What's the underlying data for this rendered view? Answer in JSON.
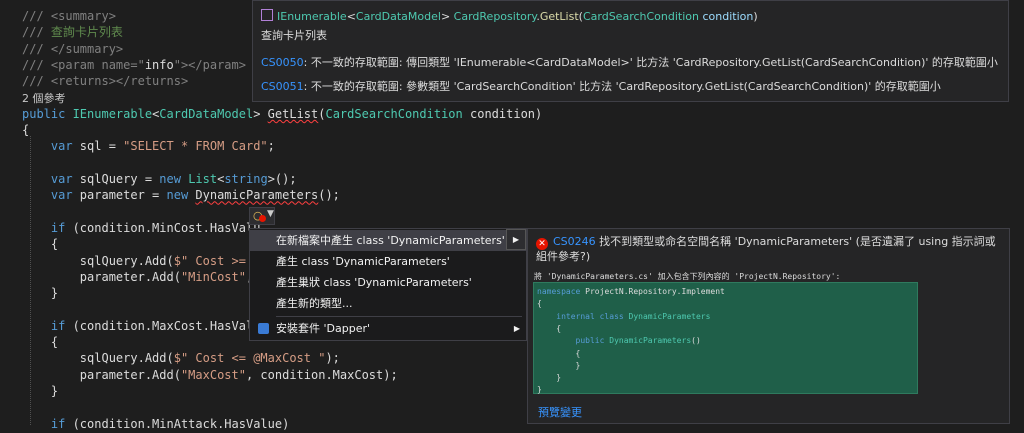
{
  "editor": {
    "lines": [
      {
        "parts": [
          {
            "c": "c-tag",
            "t": "/// "
          },
          {
            "c": "c-tag",
            "t": "<summary>"
          }
        ]
      },
      {
        "parts": [
          {
            "c": "c-tag",
            "t": "/// "
          },
          {
            "c": "c-gray",
            "t": "查詢卡片列表"
          }
        ]
      },
      {
        "parts": [
          {
            "c": "c-tag",
            "t": "/// "
          },
          {
            "c": "c-tag",
            "t": "</summary>"
          }
        ]
      },
      {
        "parts": [
          {
            "c": "c-tag",
            "t": "/// "
          },
          {
            "c": "c-tag",
            "t": "<param name=\""
          },
          {
            "c": "c-id",
            "t": "info"
          },
          {
            "c": "c-tag",
            "t": "\"></param>"
          }
        ]
      },
      {
        "parts": [
          {
            "c": "c-tag",
            "t": "/// "
          },
          {
            "c": "c-tag",
            "t": "<returns></returns>"
          }
        ]
      },
      {
        "parts": [
          {
            "c": "c-ref",
            "t": "2 個參考"
          }
        ]
      },
      {
        "parts": [
          {
            "c": "c-kw",
            "t": "public "
          },
          {
            "c": "c-type",
            "t": "IEnumerable"
          },
          {
            "c": "c-id",
            "t": "<"
          },
          {
            "c": "c-type",
            "t": "CardDataModel"
          },
          {
            "c": "c-id",
            "t": "> "
          },
          {
            "c": "c-id squig",
            "t": "GetList"
          },
          {
            "c": "c-id",
            "t": "("
          },
          {
            "c": "c-type",
            "t": "CardSearchCondition"
          },
          {
            "c": "c-id",
            "t": " condition)"
          }
        ]
      },
      {
        "parts": [
          {
            "c": "c-id",
            "t": "{"
          }
        ]
      },
      {
        "parts": [
          {
            "c": "c-kw",
            "t": "    var "
          },
          {
            "c": "c-id",
            "t": "sql = "
          },
          {
            "c": "c-str",
            "t": "\"SELECT * FROM Card\""
          },
          {
            "c": "c-id",
            "t": ";"
          }
        ]
      },
      {
        "parts": [
          {
            "c": "c-id",
            "t": ""
          }
        ]
      },
      {
        "parts": [
          {
            "c": "c-kw",
            "t": "    var "
          },
          {
            "c": "c-id",
            "t": "sqlQuery = "
          },
          {
            "c": "c-kw",
            "t": "new "
          },
          {
            "c": "c-type",
            "t": "List"
          },
          {
            "c": "c-id",
            "t": "<"
          },
          {
            "c": "c-kw",
            "t": "string"
          },
          {
            "c": "c-id",
            "t": ">();"
          }
        ]
      },
      {
        "parts": [
          {
            "c": "c-kw",
            "t": "    var "
          },
          {
            "c": "c-id",
            "t": "parameter = "
          },
          {
            "c": "c-kw",
            "t": "new "
          },
          {
            "c": "c-id squig",
            "t": "DynamicParameters"
          },
          {
            "c": "c-id",
            "t": "();"
          }
        ]
      },
      {
        "parts": [
          {
            "c": "c-id",
            "t": ""
          }
        ]
      },
      {
        "parts": [
          {
            "c": "c-kw",
            "t": "    if "
          },
          {
            "c": "c-id",
            "t": "(condition.MinCost.HasValu"
          }
        ]
      },
      {
        "parts": [
          {
            "c": "c-id",
            "t": "    {"
          }
        ]
      },
      {
        "parts": [
          {
            "c": "c-id",
            "t": "        sqlQuery.Add("
          },
          {
            "c": "c-str",
            "t": "$\" Cost >= @"
          }
        ]
      },
      {
        "parts": [
          {
            "c": "c-id",
            "t": "        parameter.Add("
          },
          {
            "c": "c-str",
            "t": "\"MinCost\""
          },
          {
            "c": "c-id",
            "t": ","
          }
        ]
      },
      {
        "parts": [
          {
            "c": "c-id",
            "t": "    }"
          }
        ]
      },
      {
        "parts": [
          {
            "c": "c-id",
            "t": ""
          }
        ]
      },
      {
        "parts": [
          {
            "c": "c-kw",
            "t": "    if "
          },
          {
            "c": "c-id",
            "t": "(condition.MaxCost.HasValu"
          }
        ]
      },
      {
        "parts": [
          {
            "c": "c-id",
            "t": "    {"
          }
        ]
      },
      {
        "parts": [
          {
            "c": "c-id",
            "t": "        sqlQuery.Add("
          },
          {
            "c": "c-str",
            "t": "$\" Cost <= @MaxCost \""
          },
          {
            "c": "c-id",
            "t": ");"
          }
        ]
      },
      {
        "parts": [
          {
            "c": "c-id",
            "t": "        parameter.Add("
          },
          {
            "c": "c-str",
            "t": "\"MaxCost\""
          },
          {
            "c": "c-id",
            "t": ", condition.MaxCost);"
          }
        ]
      },
      {
        "parts": [
          {
            "c": "c-id",
            "t": "    }"
          }
        ]
      },
      {
        "parts": [
          {
            "c": "c-id",
            "t": ""
          }
        ]
      },
      {
        "parts": [
          {
            "c": "c-kw",
            "t": "    if "
          },
          {
            "c": "c-id",
            "t": "(condition.MinAttack.HasValue)"
          }
        ]
      }
    ]
  },
  "tooltip": {
    "signature": {
      "type1": "IEnumerable",
      "lt": "<",
      "type2": "CardDataModel",
      "gt": "> ",
      "cls": "CardRepository",
      "dot": ".",
      "method": "GetList",
      "open": "(",
      "ptype": "CardSearchCondition",
      "pname": " condition",
      "close": ")"
    },
    "description": "查詢卡片列表",
    "errors": [
      {
        "code": "CS0050",
        "message": ": 不一致的存取範圍: 傳回類型 'IEnumerable<CardDataModel>' 比方法 'CardRepository.GetList(CardSearchCondition)' 的存取範圍小"
      },
      {
        "code": "CS0051",
        "message": ": 不一致的存取範圍: 參數類型 'CardSearchCondition' 比方法 'CardRepository.GetList(CardSearchCondition)' 的存取範圍小"
      }
    ]
  },
  "menu": {
    "items": [
      {
        "label": "在新檔案中產生 class 'DynamicParameters'",
        "selected": true,
        "submenu": true
      },
      {
        "label": "產生 class 'DynamicParameters'",
        "selected": false,
        "submenu": false
      },
      {
        "label": "產生巢狀 class 'DynamicParameters'",
        "selected": false,
        "submenu": false
      },
      {
        "label": "產生新的類型...",
        "selected": false,
        "submenu": false
      },
      {
        "label": "安裝套件 'Dapper'",
        "selected": false,
        "submenu": true
      }
    ]
  },
  "preview": {
    "error_code": "CS0246",
    "error_message": " 找不到類型或命名空間名稱 'DynamicParameters' (是否遺漏了 using 指示詞或組件參考?)",
    "subtitle": "將 'DynamicParameters.cs' 加入包含下列內容的 'ProjectN.Repository':",
    "code_lines": [
      {
        "parts": [
          {
            "c": "c-kw",
            "t": "namespace "
          },
          {
            "c": "c-id",
            "t": "ProjectN.Repository.Implement"
          }
        ]
      },
      {
        "parts": [
          {
            "c": "c-id",
            "t": "{"
          }
        ]
      },
      {
        "parts": [
          {
            "c": "c-kw",
            "t": "    internal class "
          },
          {
            "c": "c-type",
            "t": "DynamicParameters"
          }
        ]
      },
      {
        "parts": [
          {
            "c": "c-id",
            "t": "    {"
          }
        ]
      },
      {
        "parts": [
          {
            "c": "c-kw",
            "t": "        public "
          },
          {
            "c": "c-type",
            "t": "DynamicParameters"
          },
          {
            "c": "c-id",
            "t": "()"
          }
        ]
      },
      {
        "parts": [
          {
            "c": "c-id",
            "t": "        {"
          }
        ]
      },
      {
        "parts": [
          {
            "c": "c-id",
            "t": "        }"
          }
        ]
      },
      {
        "parts": [
          {
            "c": "c-id",
            "t": "    }"
          }
        ]
      },
      {
        "parts": [
          {
            "c": "c-id",
            "t": "}"
          }
        ]
      }
    ],
    "link": "預覽變更"
  },
  "colors": {
    "accent": "#3794ff",
    "error": "#e51400",
    "preview_bg": "#1f5f49"
  }
}
